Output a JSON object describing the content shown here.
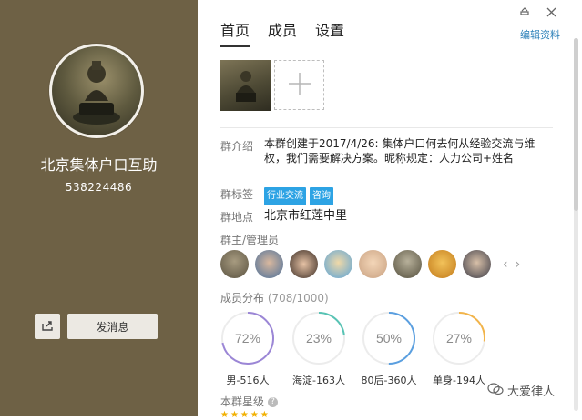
{
  "group": {
    "name": "北京集体户口互助",
    "id": "538224486"
  },
  "actions": {
    "send_message": "发消息"
  },
  "tabs": [
    {
      "label": "首页",
      "active": true
    },
    {
      "label": "成员",
      "active": false
    },
    {
      "label": "设置",
      "active": false
    }
  ],
  "edit_profile": "编辑资料",
  "info": {
    "intro_label": "群介绍",
    "intro_text": "本群创建于2017/4/26: 集体户口何去何从经验交流与维权，我们需要解决方案。昵称规定：人力公司+姓名",
    "tags_label": "群标签",
    "tags": [
      "行业交流",
      "咨询"
    ],
    "location_label": "群地点",
    "location": "北京市红莲中里",
    "admins_label": "群主/管理员"
  },
  "distribution": {
    "title": "成员分布",
    "count": "(708/1000)",
    "stats": [
      {
        "percent": "72%",
        "label": "男-516人",
        "value": 72,
        "color": "#9b86d6"
      },
      {
        "percent": "23%",
        "label": "海淀-163人",
        "value": 23,
        "color": "#57c3b4"
      },
      {
        "percent": "50%",
        "label": "80后-360人",
        "value": 50,
        "color": "#5a9fe0"
      },
      {
        "percent": "27%",
        "label": "单身-194人",
        "value": 27,
        "color": "#f2b44a"
      }
    ]
  },
  "stars_title": "本群星级",
  "watermark": "大爱律人",
  "icons": {
    "share": "share-icon",
    "add": "plus-icon",
    "help": "question-icon",
    "pin": "pin-icon",
    "close": "close-icon"
  }
}
